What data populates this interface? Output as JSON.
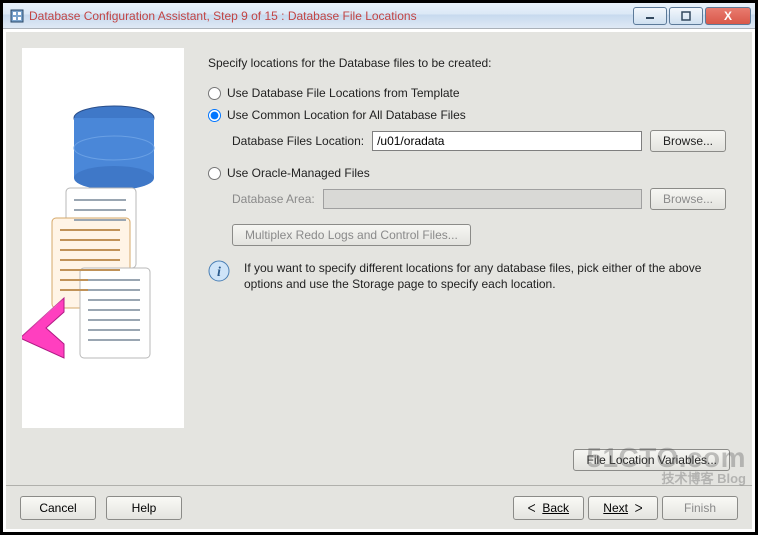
{
  "window": {
    "title": "Database Configuration Assistant, Step 9 of 15 : Database File Locations"
  },
  "heading": "Specify locations for the Database files to be created:",
  "options": {
    "template": "Use Database File Locations from Template",
    "common": "Use Common Location for All Database Files",
    "omf": "Use Oracle-Managed Files"
  },
  "common": {
    "label": "Database Files Location:",
    "value": "/u01/oradata",
    "browse": "Browse..."
  },
  "omf": {
    "label": "Database Area:",
    "value": "",
    "browse": "Browse...",
    "multiplex": "Multiplex Redo Logs and Control Files..."
  },
  "info": "If you want to specify different locations for any database files, pick either of the above options and use the Storage page to specify each location.",
  "fileLocVars": "File Location Variables...",
  "footer": {
    "cancel": "Cancel",
    "help": "Help",
    "back": "Back",
    "next": "Next",
    "finish": "Finish"
  },
  "watermark": {
    "line1": "51CTO.com",
    "line2": "技术博客 Blog"
  }
}
